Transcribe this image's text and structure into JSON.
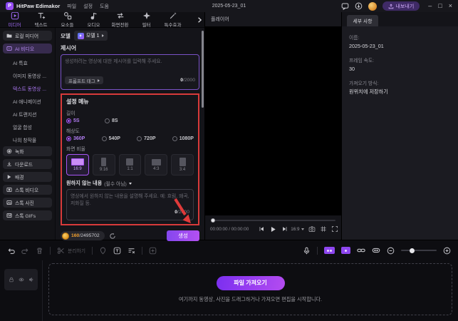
{
  "colors": {
    "accent": "#a855f7",
    "annotation_red": "#e03a3a",
    "selected_sidebar": "#372b4e"
  },
  "titlebar": {
    "logo_letter": "P",
    "app_name": "HitPaw Edimakor",
    "menus": [
      "파일",
      "설정",
      "도움"
    ],
    "window_title": "2025-05-23_01",
    "export_label": "내보내기",
    "window_buttons": [
      "–",
      "□",
      "×"
    ]
  },
  "tabs": [
    "미디어",
    "텍스트",
    "요소들",
    "오디오",
    "화면전환",
    "필터",
    "특수효과"
  ],
  "sidebar": {
    "local_media": "로컬 미디어",
    "ai_video": "AI 비디오",
    "sub_items": [
      "AI 특효",
      "이미지 동영상 ...",
      "텍스트 동영상 ...",
      "AI 애니메이션",
      "AI 트랜지션",
      "얼굴 합성",
      "나의 창작물"
    ],
    "groups": [
      "녹화",
      "다운로드",
      "배경",
      "스톡 비디오",
      "스톡 사진",
      "스톡 GIFs"
    ]
  },
  "panel": {
    "model_label": "모델",
    "model_tab": "모델 1",
    "prompt_label": "제시어",
    "prompt_placeholder": "생성하려는 영상에 대한 제시어를 입력해 주세요.",
    "prompt_tag": "프롬프트 태그",
    "prompt_counter_current": "0",
    "prompt_counter_max": "/2000",
    "settings": {
      "title": "설정 메뉴",
      "length_label": "길이",
      "length_options": [
        "5S",
        "8S"
      ],
      "resolution_label": "해상도",
      "resolution_options": [
        "360P",
        "540P",
        "720P",
        "1080P"
      ],
      "ratio_label": "화면 비율",
      "ratio_options": [
        "16:9",
        "9:16",
        "1:1",
        "4:3",
        "3:4"
      ],
      "negative_label": "원하지 않는 내용",
      "negative_optional": "(필수 아님)",
      "negative_placeholder": "영상에서 원하지 않는 내용을 설명해 주세요. 예: 흐림, 왜곡, 저화질 등.",
      "negative_counter_current": "0",
      "negative_counter_max": "/2000"
    },
    "credits_used": "160",
    "credits_total": "/2495702",
    "generate_label": "생성"
  },
  "player": {
    "header": "플레이어",
    "time_current": "00:00:00",
    "time_separator": "/",
    "time_total": "00:00:00",
    "ratio": "16:9"
  },
  "details": {
    "header": "세부 사항",
    "name_label": "이름:",
    "name_value": "2025-05-23_01",
    "fps_label": "프레임 속도:",
    "fps_value": "30",
    "import_label": "가져오기 방식:",
    "import_value": "원위치에 저장하기"
  },
  "timeline": {
    "split_label": "분리하기",
    "import_button": "파일 가져오기",
    "import_hint": "여기까지 동영상, 사진을 드래그하거나 가져오면 편집을 시작합니다."
  }
}
